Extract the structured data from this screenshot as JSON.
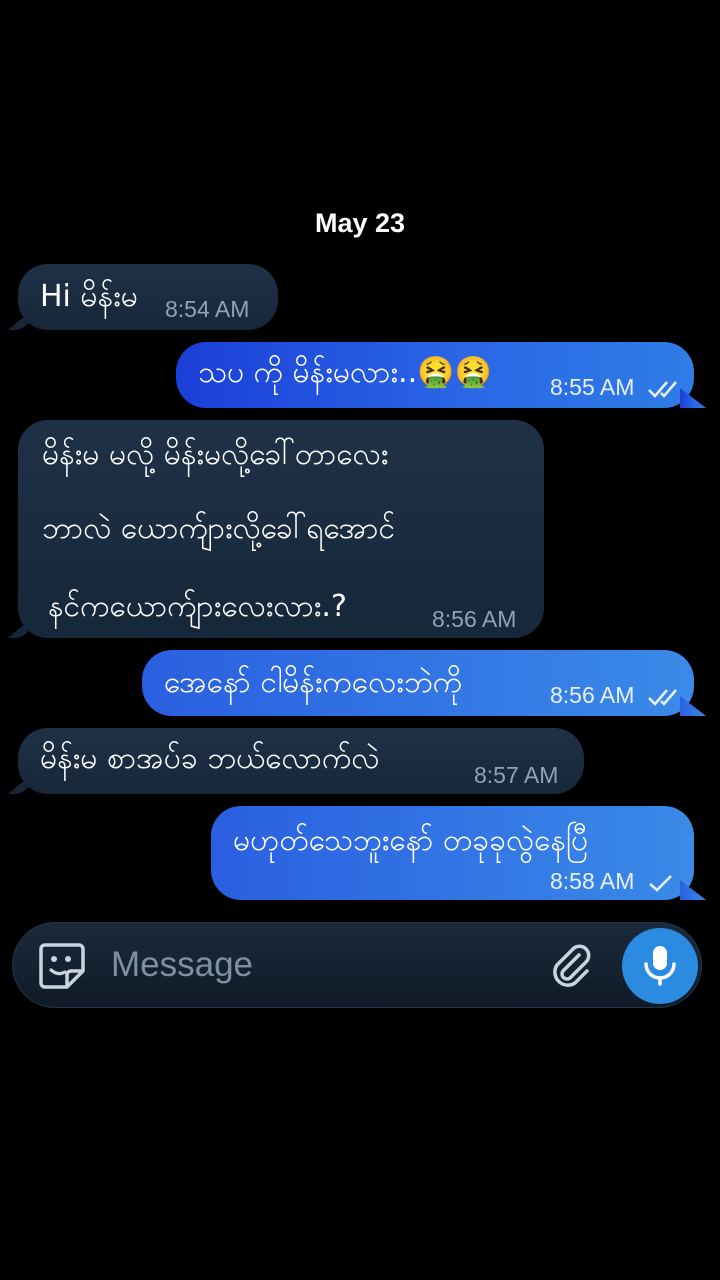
{
  "date_header": "May 23",
  "messages": [
    {
      "direction": "in",
      "lines": [
        "Hi မိန်းမ"
      ],
      "time": "8:54 AM"
    },
    {
      "direction": "out",
      "lines": [
        "သပ ကို မိန်းမလား..🤮🤮"
      ],
      "time": "8:55 AM",
      "status": "read"
    },
    {
      "direction": "in",
      "lines": [
        "မိန်းမ မလို့ မိန်းမလို့ခေါ်တာလေး",
        "ဘာလဲ ယောက်ျားလို့ခေါ်ရအောင်",
        "နင်ကယောက်ျားလေးလား.?"
      ],
      "time": "8:56 AM"
    },
    {
      "direction": "out",
      "lines": [
        "အေနော် ငါမိန်းကလေးဘဲကို"
      ],
      "time": "8:56 AM",
      "status": "read"
    },
    {
      "direction": "in",
      "lines": [
        "မိန်းမ စာအပ်ခ ဘယ်လောက်လဲ"
      ],
      "time": "8:57 AM"
    },
    {
      "direction": "out",
      "lines": [
        "မဟုတ်သေဘူးနော် တခုခုလွဲနေပြီ"
      ],
      "time": "8:58 AM",
      "status": "sent"
    }
  ],
  "composer": {
    "placeholder": "Message",
    "emoji_icon": "sticker-icon",
    "attach_icon": "paperclip-icon",
    "mic_icon": "microphone-icon"
  },
  "colors": {
    "background": "#000000",
    "incoming_bubble": "#1c2d42",
    "outgoing_bubble": "#2a66e6",
    "mic_button": "#2b8be0"
  }
}
